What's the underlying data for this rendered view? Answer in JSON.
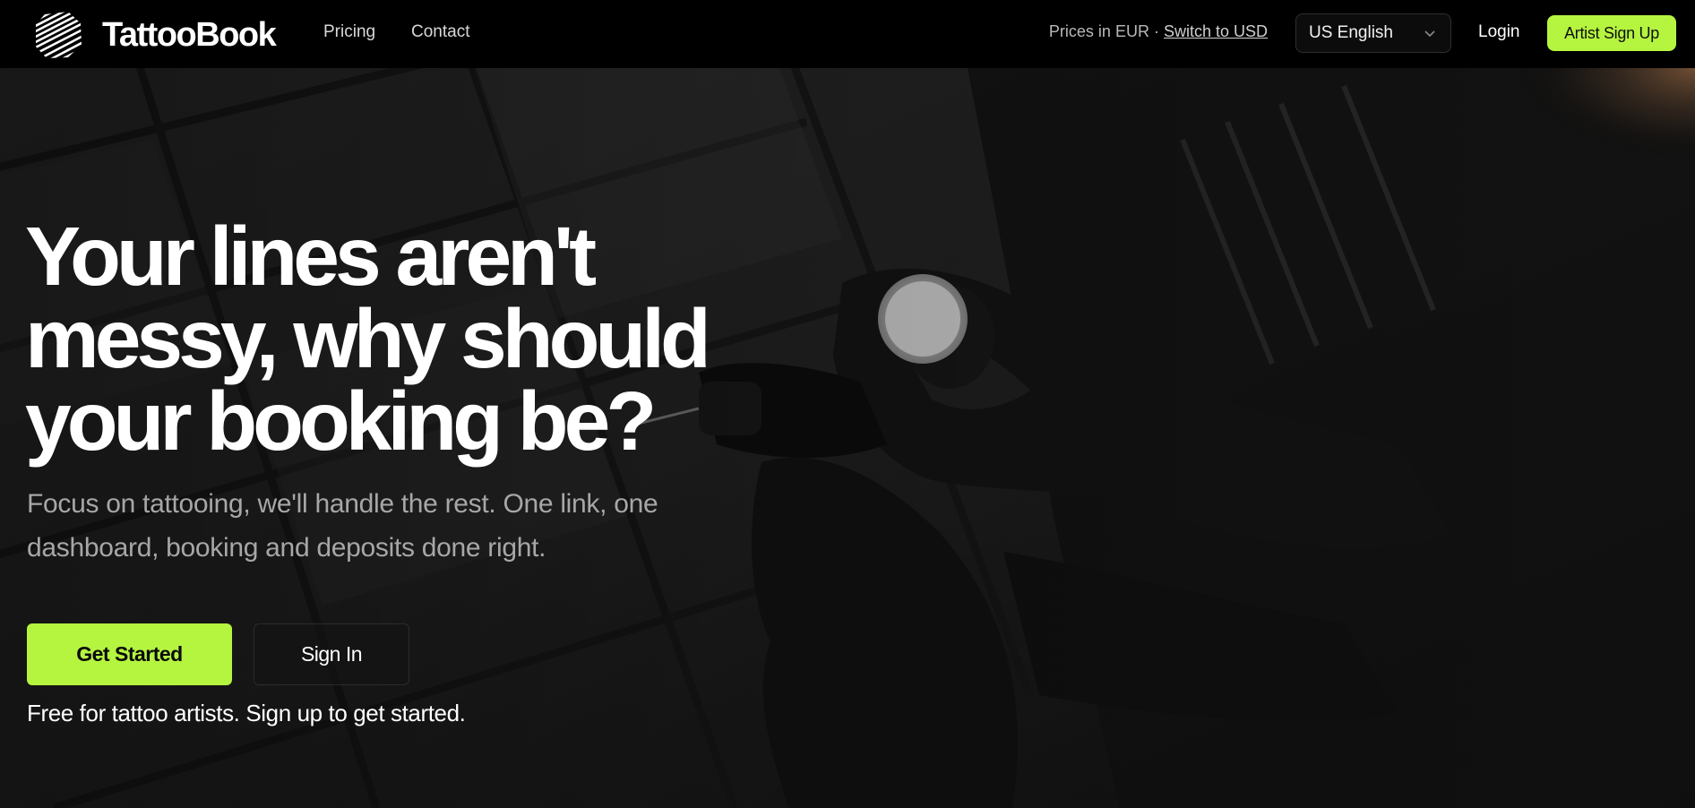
{
  "navbar": {
    "brand": "TattooBook",
    "links": [
      "Pricing",
      "Contact"
    ],
    "price_prefix": "Prices in EUR · ",
    "price_switch": "Switch to USD",
    "language": "US English",
    "login": "Login",
    "signup": "Artist Sign Up"
  },
  "hero": {
    "headline": "Your lines aren't messy, why should your booking be?",
    "subtitle": "Focus on tattooing, we'll handle the rest. One link, one dashboard, booking and deposits done right.",
    "primary_cta": "Get Started",
    "secondary_cta": "Sign In",
    "note": "Free for tattoo artists. Sign up to get started."
  },
  "colors": {
    "accent": "#b5f53f",
    "background": "#000000",
    "text_primary": "#ffffff",
    "text_muted": "#a7a7a7"
  },
  "icons": {
    "logo": "striped-shield-logo",
    "language_dropdown": "chevron-down-icon"
  }
}
